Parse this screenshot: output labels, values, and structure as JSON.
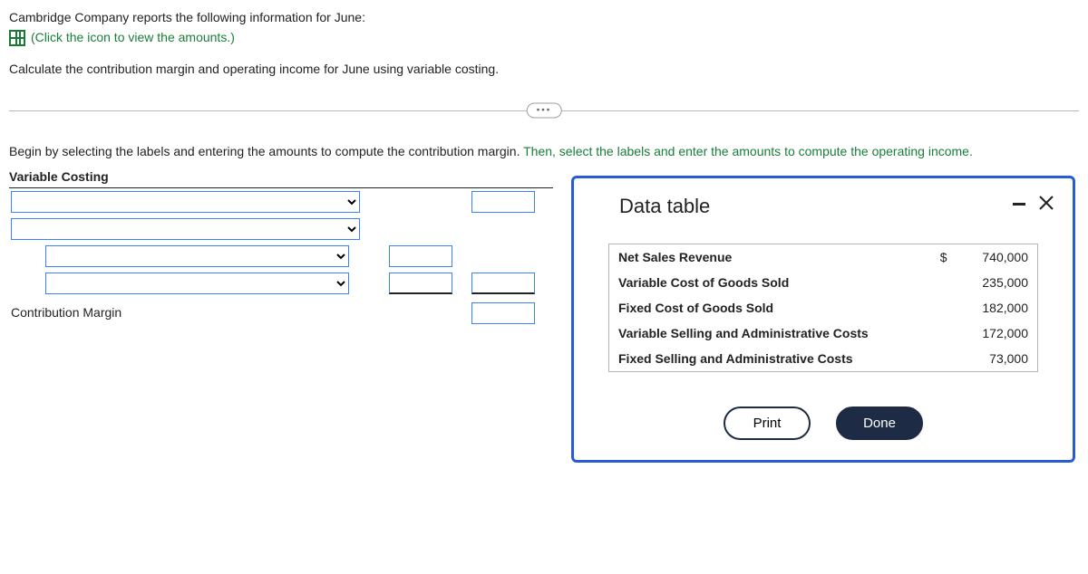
{
  "intro": {
    "line1": "Cambridge Company reports the following information for June:",
    "link_text": "(Click the icon to view the amounts.)",
    "line2": "Calculate the contribution margin and operating income for June using variable costing."
  },
  "instruction_line": {
    "pre": "Begin by selecting the labels and entering the amounts to compute the contribution margin. ",
    "post": "Then, select the labels and enter the amounts to compute the operating income."
  },
  "worksheet": {
    "heading": "Variable Costing",
    "cm_label": "Contribution Margin"
  },
  "modal": {
    "title": "Data table",
    "print": "Print",
    "done": "Done"
  },
  "chart_data": {
    "type": "table",
    "title": "Data table",
    "currency": "$",
    "rows": [
      {
        "label": "Net Sales Revenue",
        "value": 740000
      },
      {
        "label": "Variable Cost of Goods Sold",
        "value": 235000
      },
      {
        "label": "Fixed Cost of Goods Sold",
        "value": 182000
      },
      {
        "label": "Variable Selling and Administrative Costs",
        "value": 172000
      },
      {
        "label": "Fixed Selling and Administrative Costs",
        "value": 73000
      }
    ]
  }
}
